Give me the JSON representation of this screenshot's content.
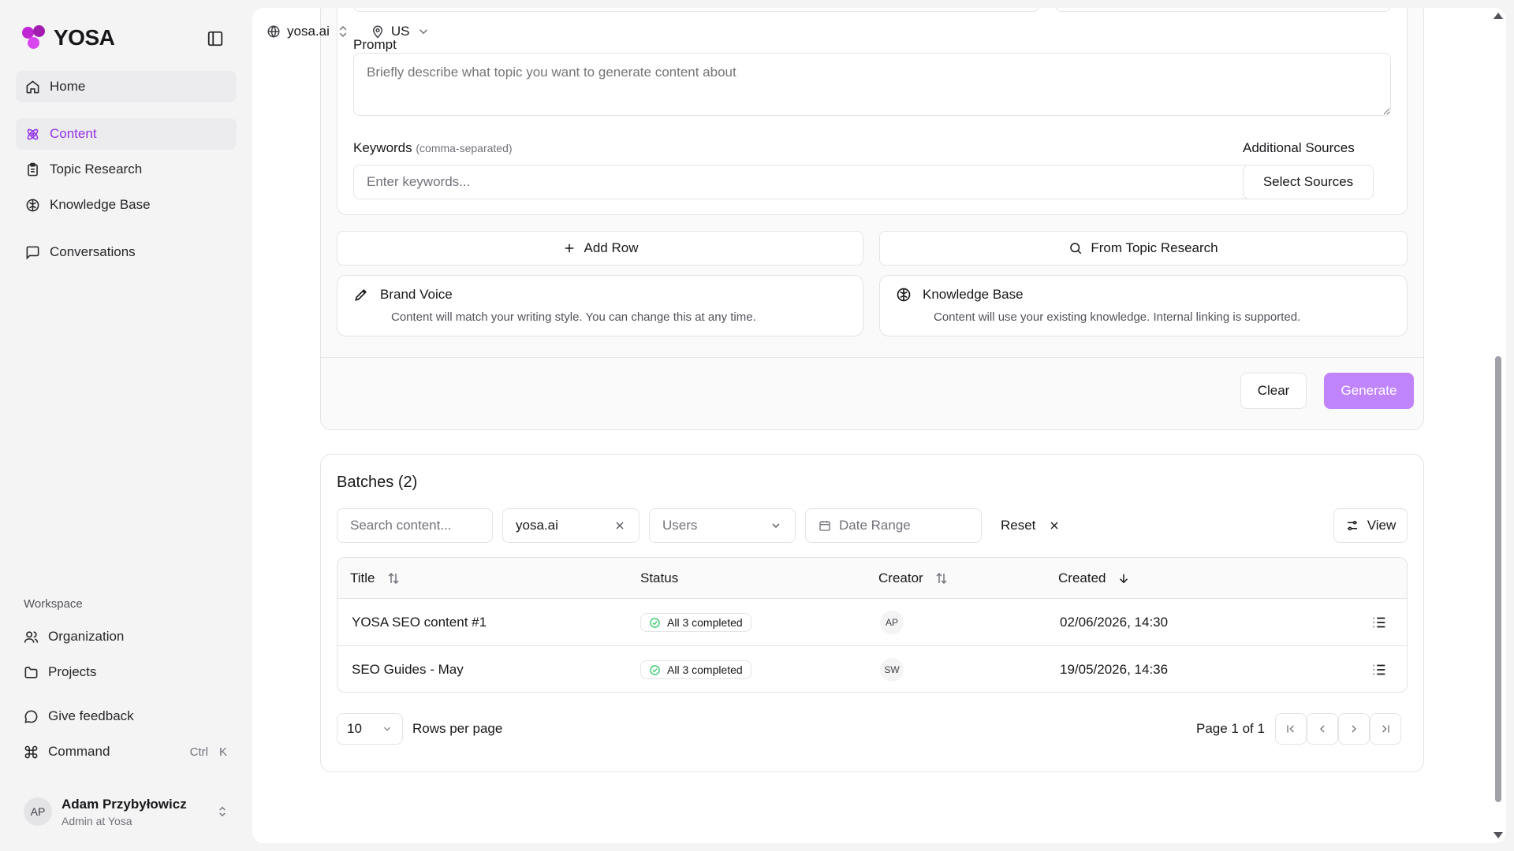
{
  "brand": {
    "name": "YOSA",
    "accent": "#c026d3"
  },
  "sidebar": {
    "items": [
      {
        "label": "Home",
        "icon": "home-icon"
      },
      {
        "label": "Content",
        "icon": "atom-icon",
        "active": true
      },
      {
        "label": "Topic Research",
        "icon": "clipboard-icon"
      },
      {
        "label": "Knowledge Base",
        "icon": "brain-icon"
      },
      {
        "label": "Conversations",
        "icon": "message-square-icon"
      }
    ],
    "workspace_label": "Workspace",
    "workspace_items": [
      {
        "label": "Organization",
        "icon": "users-icon"
      },
      {
        "label": "Projects",
        "icon": "folder-icon"
      }
    ],
    "footer_items": [
      {
        "label": "Give feedback",
        "icon": "message-circle-icon"
      },
      {
        "label": "Command",
        "icon": "command-icon",
        "kbd": [
          "Ctrl",
          "K"
        ]
      }
    ],
    "user": {
      "initials": "AP",
      "name": "Adam Przybyłowicz",
      "role": "Admin at Yosa"
    }
  },
  "topbar": {
    "site": "yosa.ai",
    "country": "US"
  },
  "form": {
    "prompt_label": "Prompt",
    "prompt_placeholder": "Briefly describe what topic you want to generate content about",
    "keywords_label": "Keywords",
    "keywords_hint": "(comma-separated)",
    "keywords_placeholder": "Enter keywords...",
    "sources_label": "Additional Sources",
    "sources_button": "Select Sources",
    "add_row": "Add Row",
    "from_topic": "From Topic Research",
    "brand_voice_title": "Brand Voice",
    "brand_voice_desc": "Content will match your writing style. You can change this at any time.",
    "kb_title": "Knowledge Base",
    "kb_desc": "Content will use your existing knowledge. Internal linking is supported.",
    "clear": "Clear",
    "generate": "Generate",
    "generate_color": "#c084fc"
  },
  "batches": {
    "title": "Batches (2)",
    "search_placeholder": "Search content...",
    "site_filter": "yosa.ai",
    "users_placeholder": "Users",
    "date_placeholder": "Date Range",
    "reset": "Reset",
    "view": "View",
    "columns": {
      "title": "Title",
      "status": "Status",
      "creator": "Creator",
      "created": "Created"
    },
    "rows": [
      {
        "title": "YOSA SEO content #1",
        "status": "All 3 completed",
        "creator": "AP",
        "created": "02/06/2026, 14:30"
      },
      {
        "title": "SEO Guides - May",
        "status": "All 3 completed",
        "creator": "SW",
        "created": "19/05/2026, 14:36"
      }
    ],
    "rows_per_page_value": "10",
    "rows_per_page_label": "Rows per page",
    "page_info": "Page 1 of 1"
  }
}
